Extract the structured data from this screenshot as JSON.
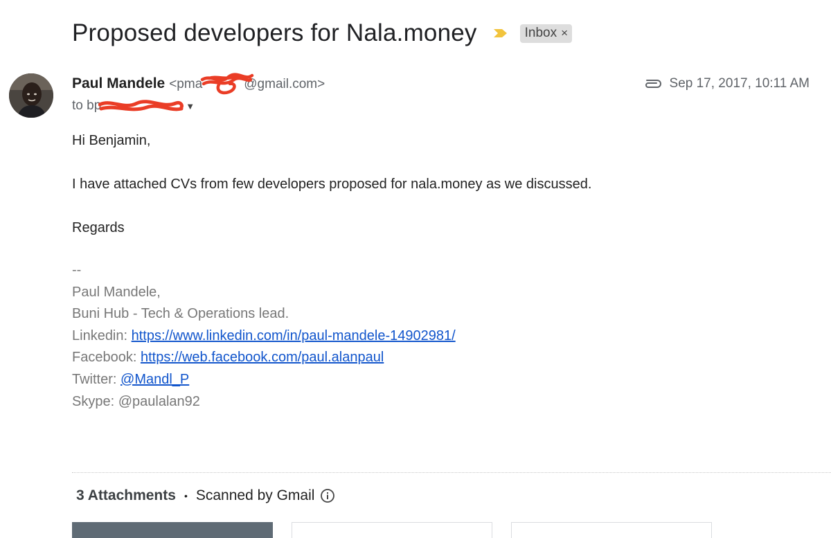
{
  "subject": "Proposed developers for Nala.money",
  "label": {
    "name": "Inbox",
    "remove_glyph": "×"
  },
  "sender": {
    "name": "Paul Mandele",
    "email_prefix": "<pma",
    "email_suffix": "@gmail.com>"
  },
  "recipient": {
    "text": "to bp"
  },
  "meta": {
    "timestamp": "Sep 17, 2017, 10:11 AM",
    "attachment_icon": "paperclip-icon"
  },
  "body": {
    "greeting": "Hi Benjamin,",
    "paragraph": "I have attached CVs from few developers proposed for nala.money as we discussed.",
    "closing": "Regards"
  },
  "signature": {
    "separator": "--",
    "name": "Paul Mandele,",
    "role": "Buni Hub - Tech & Operations lead.",
    "linkedin_label": "Linkedin: ",
    "linkedin_url": "https://www.linkedin.com/in/paul-mandele-14902981/",
    "facebook_label": "Facebook: ",
    "facebook_url": "https://web.facebook.com/paul.alanpaul",
    "twitter_label": "Twitter: ",
    "twitter_handle": "@Mandl_P",
    "skype": "Skype: @paulalan92"
  },
  "attachments": {
    "count_label": "3 Attachments",
    "bullet": "•",
    "scan_label": "Scanned by Gmail"
  },
  "colors": {
    "link": "#1155cc",
    "importance": "#f2c43d",
    "redaction": "#ea3d26"
  }
}
